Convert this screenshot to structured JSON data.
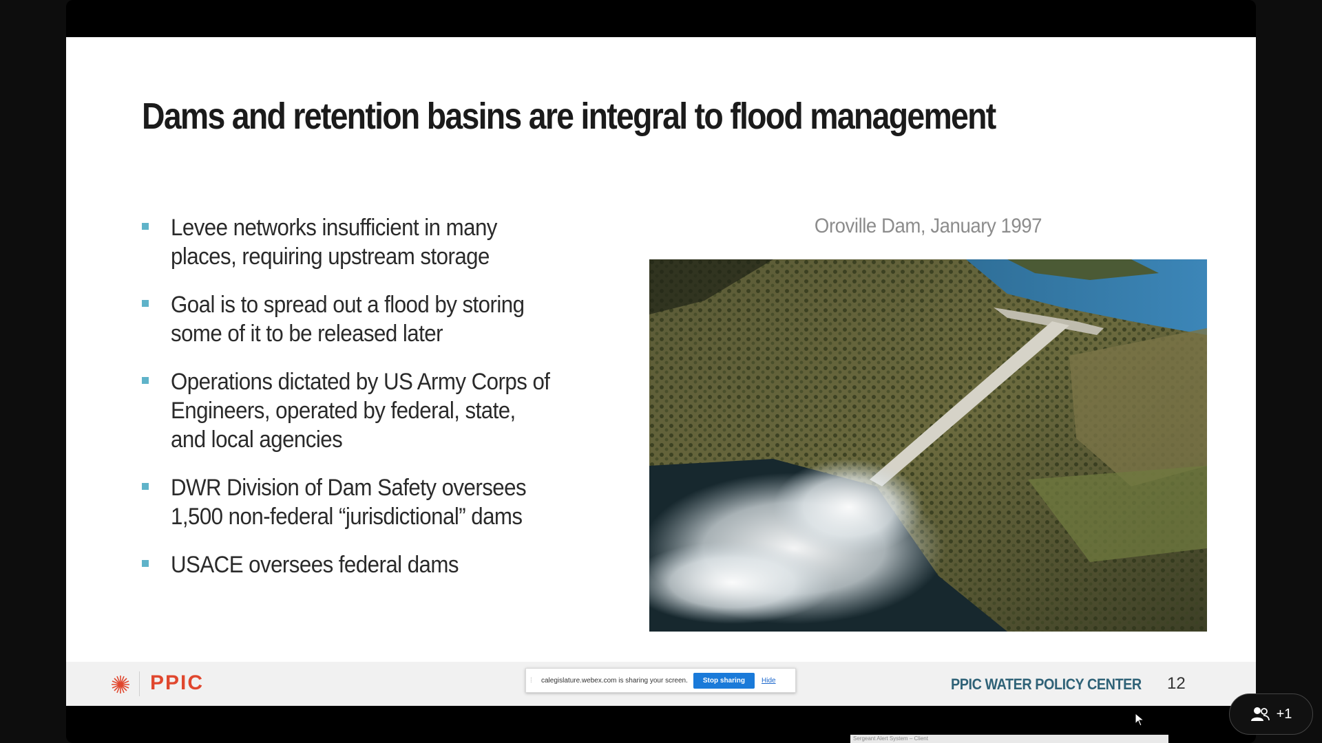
{
  "slide": {
    "title": "Dams and retention basins are integral to flood management",
    "bullets": [
      "Levee networks insufficient in many places, requiring upstream storage",
      "Goal is to spread out a flood by storing some of it to be released later",
      "Operations dictated by US Army Corps of Engineers, operated by federal, state, and local agencies",
      "DWR Division of Dam Safety oversees 1,500 non-federal “jurisdictional” dams",
      "USACE oversees federal dams"
    ],
    "photo_caption": "Oroville Dam, January 1997",
    "footer": {
      "logo_text": "PPIC",
      "center_text": "PPIC WATER POLICY CENTER",
      "page_number": "12"
    },
    "colors": {
      "bullet_marker": "#5fb3c9",
      "logo": "#e0472e",
      "footer_text": "#2f6277"
    }
  },
  "share_bar": {
    "message": "calegislature.webex.com is sharing your screen.",
    "stop_label": "Stop sharing",
    "hide_label": "Hide"
  },
  "participants": {
    "icon": "people-icon",
    "count_label": "+1"
  },
  "bottom_strip": {
    "text": "Sergeant Alert System – Client"
  }
}
